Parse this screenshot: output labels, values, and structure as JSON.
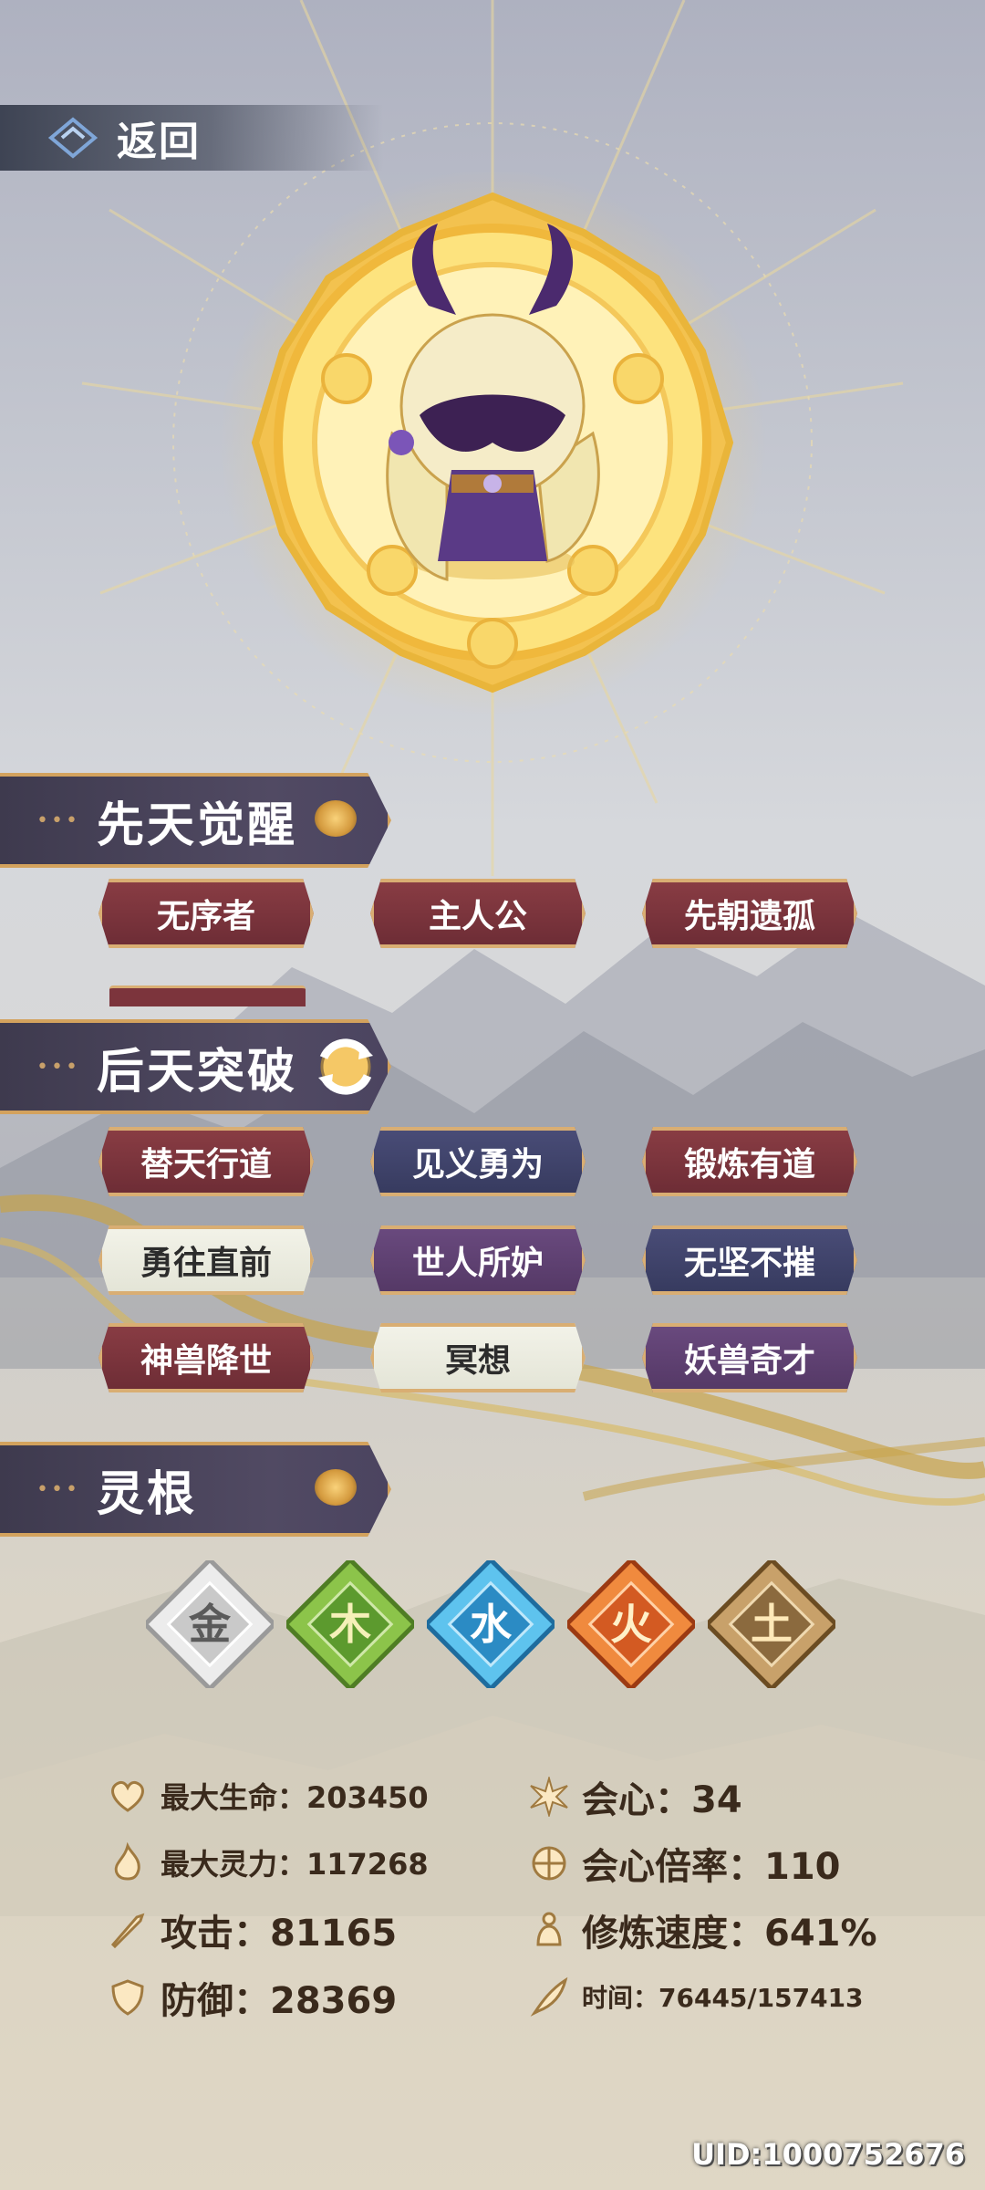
{
  "header": {
    "back_label": "返回"
  },
  "sections": {
    "innate": {
      "title": "先天觉醒",
      "tags": [
        {
          "label": "无序者",
          "color": "red"
        },
        {
          "label": "主人公",
          "color": "red"
        },
        {
          "label": "先朝遗孤",
          "color": "red"
        }
      ]
    },
    "acquired": {
      "title": "后天突破",
      "tags": [
        {
          "label": "替天行道",
          "color": "red"
        },
        {
          "label": "见义勇为",
          "color": "blue"
        },
        {
          "label": "锻炼有道",
          "color": "red"
        },
        {
          "label": "勇往直前",
          "color": "white"
        },
        {
          "label": "世人所妒",
          "color": "purple"
        },
        {
          "label": "无坚不摧",
          "color": "blue"
        },
        {
          "label": "神兽降世",
          "color": "red"
        },
        {
          "label": "冥想",
          "color": "white"
        },
        {
          "label": "妖兽奇才",
          "color": "purple"
        }
      ]
    },
    "spirit_root": {
      "title": "灵根",
      "elements": [
        {
          "glyph": "金",
          "color": "#a9a9a9"
        },
        {
          "glyph": "木",
          "color": "#5c9a2e"
        },
        {
          "glyph": "水",
          "color": "#2b8bc4"
        },
        {
          "glyph": "火",
          "color": "#d35a22"
        },
        {
          "glyph": "土",
          "color": "#8b6a3e"
        }
      ]
    }
  },
  "stats": {
    "max_hp": "最大生命：203450",
    "crit": "会心：34",
    "max_spirit": "最大灵力：117268",
    "crit_rate": "会心倍率：110",
    "attack": "攻击：81165",
    "cultivate_speed": "修炼速度：641%",
    "defense": "防御：28369",
    "time": "时间：76445/157413"
  },
  "footer": {
    "uid": "UID:1000752676"
  },
  "colors": {
    "gold": "#d3a25d",
    "header_bg": "#4a4460",
    "text_dark": "#3a2a1c"
  }
}
